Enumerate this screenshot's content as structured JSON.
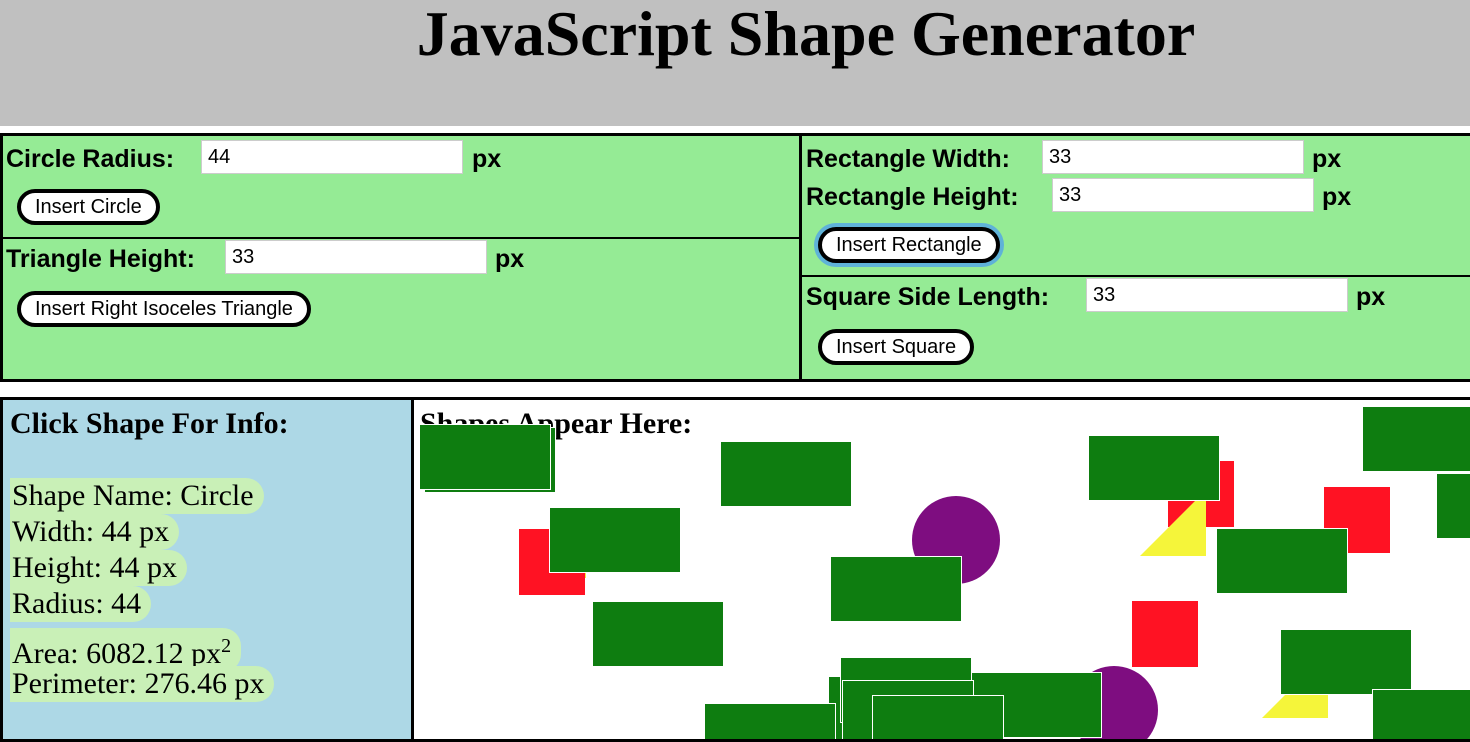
{
  "header": {
    "title": "JavaScript Shape Generator"
  },
  "circle": {
    "label": "Circle Radius:",
    "value": "44",
    "unit": "px",
    "button": "Insert Circle"
  },
  "triangle": {
    "label": "Triangle Height:",
    "value": "33",
    "unit": "px",
    "button": "Insert Right Isoceles Triangle"
  },
  "rectangle": {
    "width_label": "Rectangle Width:",
    "width_value": "33",
    "width_unit": "px",
    "height_label": "Rectangle Height:",
    "height_value": "33",
    "height_unit": "px",
    "button": "Insert Rectangle"
  },
  "square": {
    "label": "Square Side Length:",
    "value": "33",
    "unit": "px",
    "button": "Insert Square"
  },
  "info": {
    "title": "Click Shape For Info:",
    "shape_name": "Shape Name: Circle",
    "width": "Width: 44 px",
    "height": "Height: 44 px",
    "radius": "Radius: 44",
    "area_text": "Area: 6082.12 px",
    "area_exponent": "2",
    "perimeter": "Perimeter: 276.46 px"
  },
  "canvas": {
    "title": "Shapes Appear Here:"
  },
  "colors": {
    "header_bg": "#c0c0c0",
    "controls_bg": "#95eb95",
    "info_bg": "#add8e6",
    "info_highlight": "#c9f0b7",
    "rectangle": "#0e7d10",
    "square": "#ff1223",
    "circle": "#7e0d80",
    "triangle": "#f5f53a",
    "focus_ring": "#5fb2d8"
  }
}
